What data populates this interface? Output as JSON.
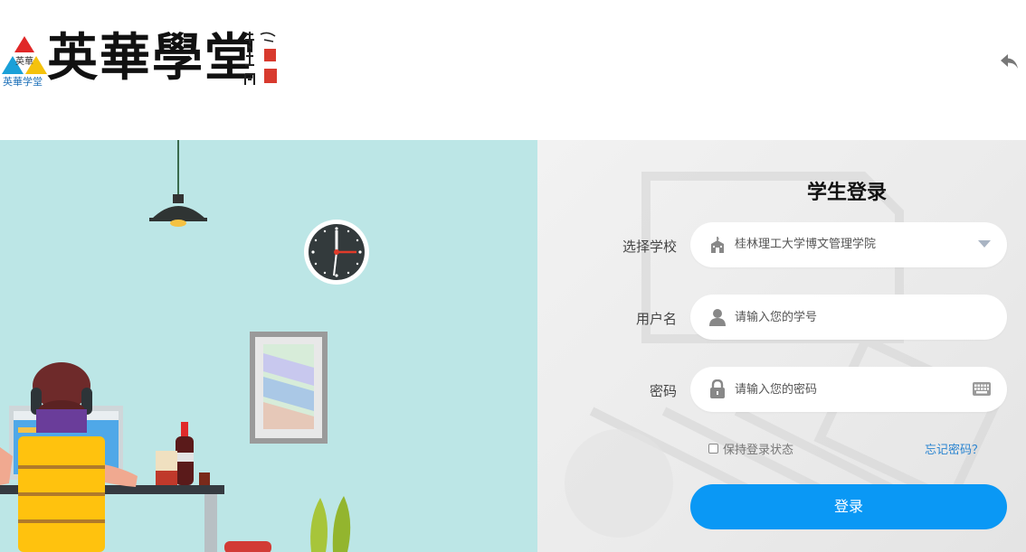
{
  "header": {
    "logo_caption": "英華学堂",
    "logo_calligraphy": "英華學堂",
    "back_icon": "reply-arrow-icon"
  },
  "login": {
    "title": "学生登录",
    "school_label": "选择学校",
    "school_value": "桂林理工大学博文管理学院",
    "username_label": "用户名",
    "username_placeholder": "请输入您的学号",
    "password_label": "密码",
    "password_placeholder": "请输入您的密码",
    "remember_label": "保持登录状态",
    "forgot_link": "忘记密码？",
    "submit_label": "登录"
  },
  "colors": {
    "accent": "#0a98f5",
    "link": "#2a84d0",
    "illustration_bg": "#bce6e6",
    "chair": "#ffc20e"
  }
}
